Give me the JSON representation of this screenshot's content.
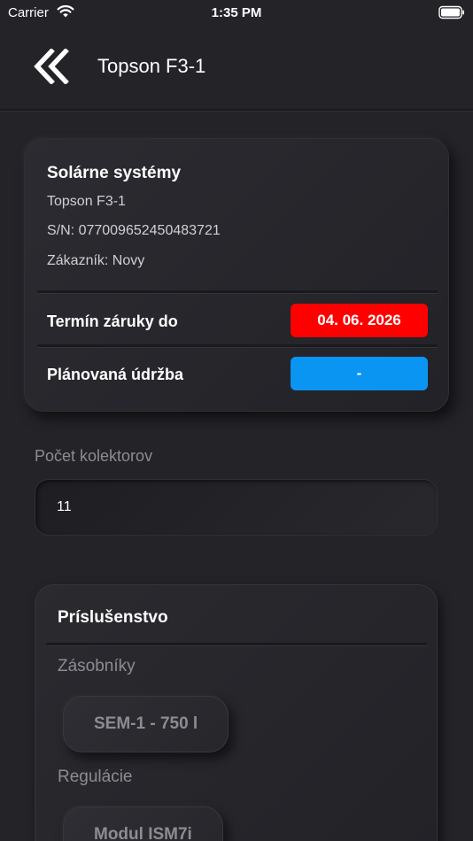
{
  "status_bar": {
    "carrier": "Carrier",
    "time": "1:35 PM"
  },
  "nav": {
    "title": "Topson F3-1",
    "back_icon": "double-chevron-left-icon"
  },
  "info_card": {
    "title": "Solárne systémy",
    "model": "Topson F3-1",
    "serial": "S/N: 077009652450483721",
    "customer": "Zákazník: Novy",
    "warranty_label": "Termín záruky do",
    "warranty_value": "04. 06. 2026",
    "maintenance_label": "Plánovaná údržba",
    "maintenance_value": "-"
  },
  "collectors": {
    "label": "Počet kolektorov",
    "value": "11"
  },
  "accessories": {
    "title": "Príslušenstvo",
    "sections": [
      {
        "label": "Zásobníky",
        "chip": "SEM-1 - 750 l"
      },
      {
        "label": "Regulácie",
        "chip": "Modul ISM7i"
      }
    ]
  },
  "colors": {
    "background": "#232328",
    "warranty_pill": "#ff0000",
    "maintenance_pill": "#0a95f2"
  }
}
